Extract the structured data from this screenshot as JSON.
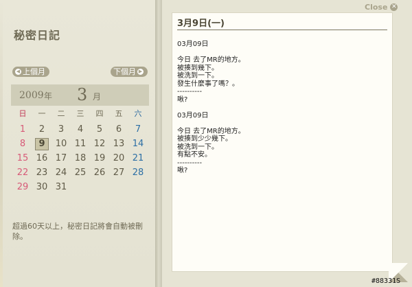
{
  "app": {
    "title": "秘密日記",
    "close_label": "Close"
  },
  "calendar": {
    "prev_label": "上個月",
    "next_label": "下個月",
    "year": "2009",
    "year_unit": "年",
    "month": "3",
    "month_unit": "月",
    "weekdays": [
      "日",
      "一",
      "二",
      "三",
      "四",
      "五",
      "六"
    ],
    "weeks": [
      [
        "",
        "",
        "",
        "",
        "",
        "",
        "",
        "1",
        "2",
        "3",
        "4",
        "5",
        "6",
        "7"
      ],
      [
        "8",
        "9",
        "10",
        "11",
        "12",
        "13",
        "14"
      ],
      [
        "15",
        "16",
        "17",
        "18",
        "19",
        "20",
        "21"
      ],
      [
        "22",
        "23",
        "24",
        "25",
        "26",
        "27",
        "28"
      ],
      [
        "29",
        "30",
        "31"
      ]
    ],
    "today": "9",
    "colors": {
      "sunday": "#d75a78",
      "saturday": "#2d6fa5"
    }
  },
  "notice": "超過60天以上，秘密日記將會自動被刪除。",
  "entry": {
    "date_heading": "3月9日(一)",
    "lines": [
      "03月09日",
      "",
      "今日 去了MR的地方。",
      "被揍到幾下。",
      "被洗到一下。",
      "發生什麼事了嗎？。",
      "----------",
      "啾?",
      "",
      "03月09日",
      "",
      "今日 去了MR的地方。",
      "被揍到少少幾下。",
      "被洗到一下。",
      "有點不安。",
      "----------",
      "啾?"
    ]
  },
  "watermark": "#88331S"
}
